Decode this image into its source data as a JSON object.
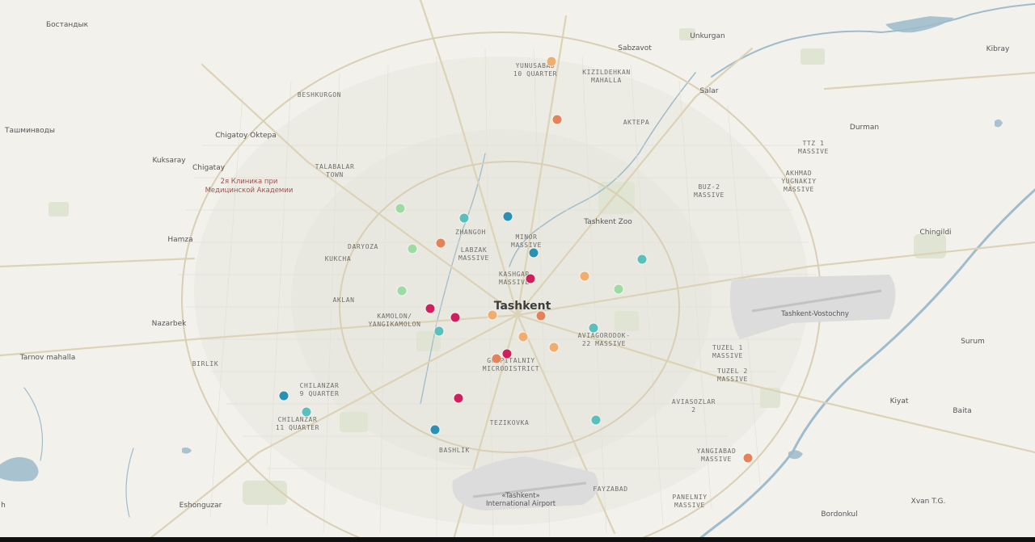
{
  "map": {
    "city_label": "Tashkent",
    "labels": {
      "bostandyk": "Бостандык",
      "tashminvody": "Ташминводы",
      "beshkurgon": "BESHKURGON",
      "chigatoy_oktepa": "Chigatoy Oktepa",
      "kuksaray": "Kuksaray",
      "chigatay": "Chigatay",
      "talabalar_town": "TALABALAR\nTOWN",
      "clinic": "2я Клиника при\nМедицинской Академии",
      "hamza": "Hamza",
      "daryoza": "DARYOZA",
      "kukcha": "KUKCHA",
      "aklan": "AKLAN",
      "nazarbek": "Nazarbek",
      "kamolon": "KAMOLON/\nYANGIKAMOLON",
      "tarnov_mahalla": "Tarnov mahalla",
      "birlik": "BIRLIK",
      "chilanzar_9": "CHILANZAR\n9 QUARTER",
      "chilanzar_11": "CHILANZAR\n11 QUARTER",
      "eshonguzar": "Eshonguzar",
      "yunusabad": "YUNUSABAD\n10 QUARTER",
      "kizildehkan": "KIZILDEHKAN\nMAHALLA",
      "sabzavot": "Sabzavot",
      "unkurgan": "Unkurgan",
      "salar": "Salar",
      "aktepa": "AKTEPA",
      "kibray": "Kibray",
      "durman": "Durman",
      "ttz1": "TTZ 1\nMASSIVE",
      "akhmad": "AKHMAD\nYUGNAKIY\nMASSIVE",
      "buz2": "BUZ-2\nMASSIVE",
      "tashkent_zoo": "Tashkent Zoo",
      "zhangoh": "ZHANGOH",
      "minor": "MINOR\nMASSIVE",
      "labzak": "LABZAK\nMASSIVE",
      "kashgar": "KASHGAR\nMASSIVE",
      "chingildi": "Chingildi",
      "vostochny": "Tashkent-Vostochny",
      "aviagorodok": "AVIAGORODOK-\n22 MASSIVE",
      "gospitalniy": "GOSPITALNIY\nMICRODISTRICT",
      "tuzel1": "TUZEL 1\nMASSIVE",
      "tuzel2": "TUZEL 2\nMASSIVE",
      "surum": "Surum",
      "aviasozlar": "AVIASOZLAR\n2",
      "kiyat": "Kiyat",
      "baita": "Baita",
      "tezikovka": "TEZIKOVKA",
      "bashlik": "BASHLIK",
      "yangiabad": "YANGIABAD\nMASSIVE",
      "airport": "«Tashkent»\nInternational Airport",
      "fayzabad": "FAYZABAD",
      "panelniy": "PANELNIY\nMASSIVE",
      "xvan": "Xvan T.G.",
      "bordonkul": "Bordonkul",
      "edge_h": "h"
    },
    "marker_colors": {
      "orange_dark": "#e4835a",
      "orange_light": "#f0ad6e",
      "crimson": "#cf1f5c",
      "teal": "#5bbfbd",
      "blue": "#2b91b4",
      "green": "#9cdca2"
    }
  }
}
